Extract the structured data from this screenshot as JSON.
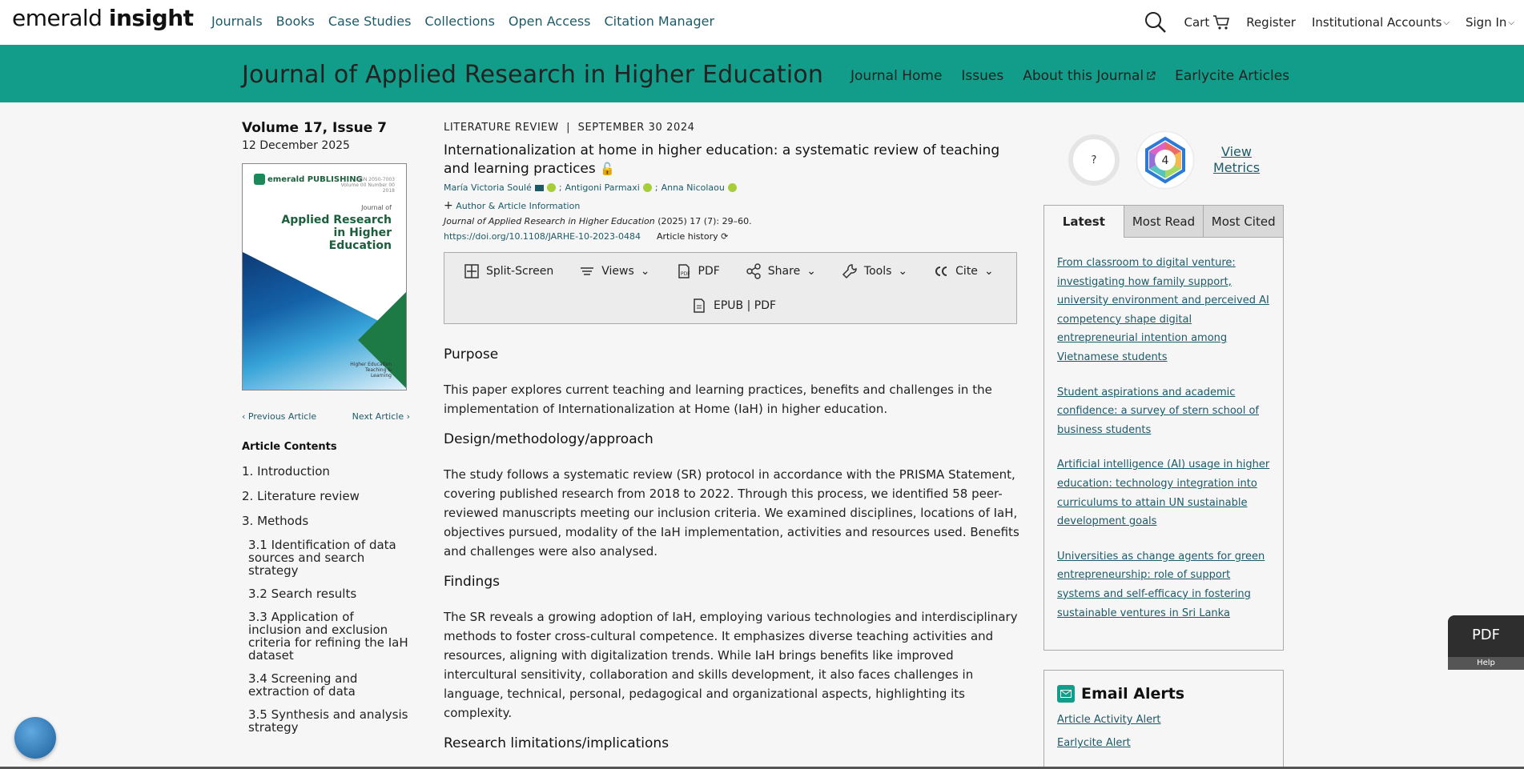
{
  "logo": {
    "part1": "emerald",
    "part2": "insight"
  },
  "nav": {
    "items": [
      "Journals",
      "Books",
      "Case Studies",
      "Collections",
      "Open Access",
      "Citation Manager"
    ]
  },
  "user_nav": {
    "cart": "Cart",
    "register": "Register",
    "institutional": "Institutional Accounts",
    "sign_in": "Sign In"
  },
  "journal": {
    "title": "Journal of Applied Research in Higher Education",
    "links": [
      "Journal Home",
      "Issues",
      "About this Journal",
      "Earlycite Articles"
    ]
  },
  "issue": {
    "volume": "Volume 17, Issue 7",
    "date": "12 December 2025"
  },
  "cover": {
    "publisher": "emerald PUBLISHING",
    "issn": "ISSN 2050-7003 Volume 00 Number 00 2018",
    "journal_of": "Journal of",
    "title": "Applied Research in Higher Education",
    "footer": "Higher Education Teaching & Learning"
  },
  "article_nav": {
    "prev": "Previous Article",
    "next": "Next Article"
  },
  "contents": {
    "title": "Article Contents",
    "items": [
      "1. Introduction",
      "2. Literature review",
      "3. Methods"
    ],
    "subitems": [
      "3.1 Identification of data sources and search strategy",
      "3.2 Search results",
      "3.3 Application of inclusion and exclusion criteria for refining the IaH dataset",
      "3.4 Screening and extraction of data",
      "3.5 Synthesis and analysis strategy"
    ]
  },
  "article": {
    "type": "LITERATURE REVIEW",
    "date": "SEPTEMBER 30 2024",
    "title": "Internationalization at home in higher education: a systematic review of teaching and learning practices",
    "authors": [
      "María Victoria Soulé",
      "Antigoni Parmaxi",
      "Anna Nicolaou"
    ],
    "author_info": "Author & Article Information",
    "citation_journal": "Journal of Applied Research in Higher Education",
    "citation_rest": " (2025) 17 (7): 29–60.",
    "doi": "https://doi.org/10.1108/JARHE-10-2023-0484",
    "history": "Article history"
  },
  "toolbar": {
    "split": "Split-Screen",
    "views": "Views",
    "pdf": "PDF",
    "share": "Share",
    "tools": "Tools",
    "cite": "Cite",
    "epub": "EPUB | PDF"
  },
  "sections": {
    "purpose_h": "Purpose",
    "purpose": "This paper explores current teaching and learning practices, benefits and challenges in the implementation of Internationalization at Home (IaH) in higher education.",
    "design_h": "Design/methodology/approach",
    "design": "The study follows a systematic review (SR) protocol in accordance with the PRISMA Statement, covering published research from 2018 to 2022. Through this process, we identified 58 peer-reviewed manuscripts meeting our inclusion criteria. We examined disciplines, locations of IaH, objectives pursued, modality of the IaH implementation, activities and resources used. Benefits and challenges were also analysed.",
    "findings_h": "Findings",
    "findings": "The SR reveals a growing adoption of IaH, employing various technologies and interdisciplinary methods to foster cross-cultural competence. It emphasizes diverse teaching activities and resources, aligning with digitalization trends. While IaH brings benefits like improved intercultural sensitivity, collaboration and skills development, it also faces challenges in language, technical, personal, pedagogical and organizational aspects, highlighting its complexity.",
    "research_h": "Research limitations/implications"
  },
  "metrics": {
    "altmetric": "?",
    "dimensions": "4",
    "view": "View Metrics"
  },
  "tabs": {
    "latest": "Latest",
    "most_read": "Most Read",
    "most_cited": "Most Cited"
  },
  "latest_articles": [
    "From classroom to digital venture: investigating how family support, university environment and perceived AI competency shape digital entrepreneurial intention among Vietnamese students",
    "Student aspirations and academic confidence: a survey of stern school of business students",
    "Artificial intelligence (AI) usage in higher education: technology integration into curriculums to attain UN sustainable development goals",
    "Universities as change agents for green entrepreneurship: role of support systems and self-efficacy in fostering sustainable ventures in Sri Lanka"
  ],
  "alerts": {
    "title": "Email Alerts",
    "items": [
      "Article Activity Alert",
      "Earlycite Alert"
    ]
  },
  "pdf_float": {
    "label": "PDF",
    "help": "Help"
  }
}
